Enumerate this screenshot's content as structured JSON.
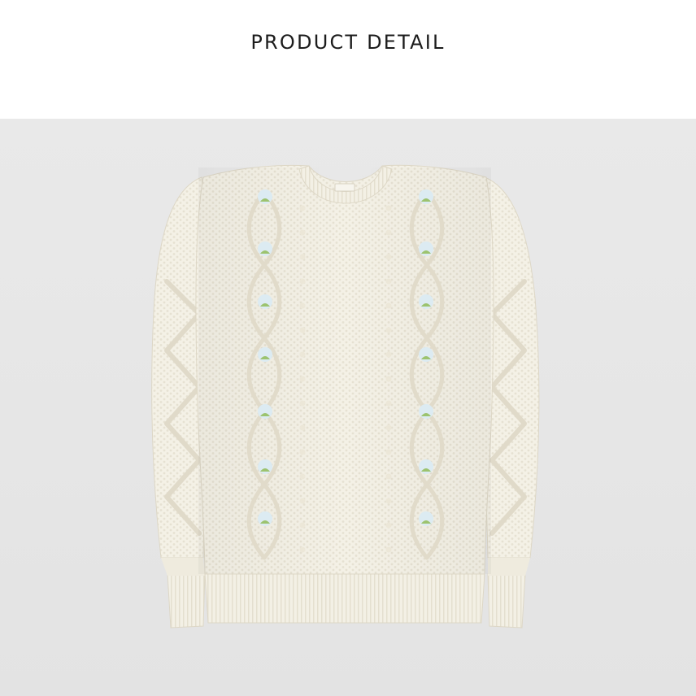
{
  "header": {
    "title": "PRODUCT DETAIL"
  },
  "product_image": {
    "subject": "sweater-icon",
    "colors": {
      "background": "#e7e7e7",
      "knit": "#f4f1e6",
      "knit_shadow": "#e2ddcd",
      "flower_leaf": "#9cc36f",
      "flower_petal": "#d9e9f2"
    }
  }
}
